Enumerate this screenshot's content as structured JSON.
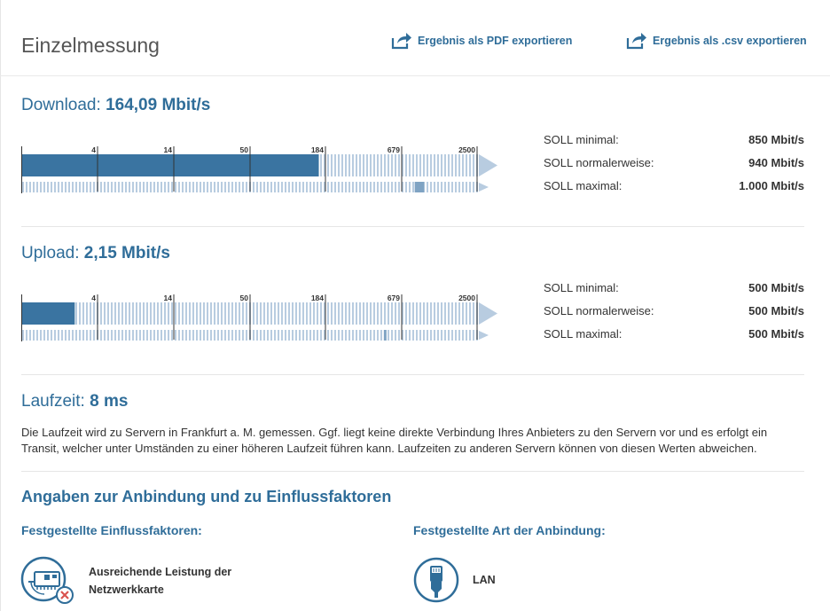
{
  "header": {
    "title": "Einzelmessung",
    "export_pdf": "Ergebnis als PDF exportieren",
    "export_csv": "Ergebnis als .csv exportieren"
  },
  "download": {
    "label": "Download:",
    "value": "164,09 Mbit/s",
    "soll": [
      {
        "label": "SOLL minimal:",
        "value": "850 Mbit/s"
      },
      {
        "label": "SOLL normalerweise:",
        "value": "940 Mbit/s"
      },
      {
        "label": "SOLL maximal:",
        "value": "1.000 Mbit/s"
      }
    ]
  },
  "upload": {
    "label": "Upload:",
    "value": "2,15 Mbit/s",
    "soll": [
      {
        "label": "SOLL minimal:",
        "value": "500 Mbit/s"
      },
      {
        "label": "SOLL normalerweise:",
        "value": "500 Mbit/s"
      },
      {
        "label": "SOLL maximal:",
        "value": "500 Mbit/s"
      }
    ]
  },
  "scale_ticks": [
    "4",
    "14",
    "50",
    "184",
    "679",
    "2500"
  ],
  "chart_data": [
    {
      "type": "bar",
      "title": "Download",
      "scale": "log",
      "ticks": [
        4,
        14,
        50,
        184,
        679,
        2500
      ],
      "measured": 164.09,
      "soll_range": [
        850,
        1000
      ],
      "unit": "Mbit/s"
    },
    {
      "type": "bar",
      "title": "Upload",
      "scale": "log",
      "ticks": [
        4,
        14,
        50,
        184,
        679,
        2500
      ],
      "measured": 2.15,
      "soll_range": [
        500,
        500
      ],
      "unit": "Mbit/s"
    }
  ],
  "latency": {
    "label": "Laufzeit:",
    "value": "8 ms",
    "description": "Die Laufzeit wird zu Servern in Frankfurt a. M. gemessen. Ggf. liegt keine direkte Verbindung Ihres Anbieters zu den Servern vor und es erfolgt ein Transit, welcher unter Umständen zu einer höheren Laufzeit führen kann. Laufzeiten zu anderen Servern können von diesen Werten abweichen."
  },
  "connection": {
    "heading": "Angaben zur Anbindung und zu Einflussfaktoren",
    "factors_heading": "Festgestellte Einflussfaktoren:",
    "type_heading": "Festgestellte Art der Anbindung:",
    "factor_label_line1": "Ausreichende Leistung der",
    "factor_label_line2": "Netzwerkkarte",
    "connection_type": "LAN"
  },
  "colors": {
    "accent": "#2f6d99",
    "bar_fill": "#3a74a1",
    "stripe": "#b8cce0",
    "warning": "#d9534f"
  },
  "icons": [
    "export-icon",
    "network-card-icon",
    "lan-plug-icon"
  ]
}
